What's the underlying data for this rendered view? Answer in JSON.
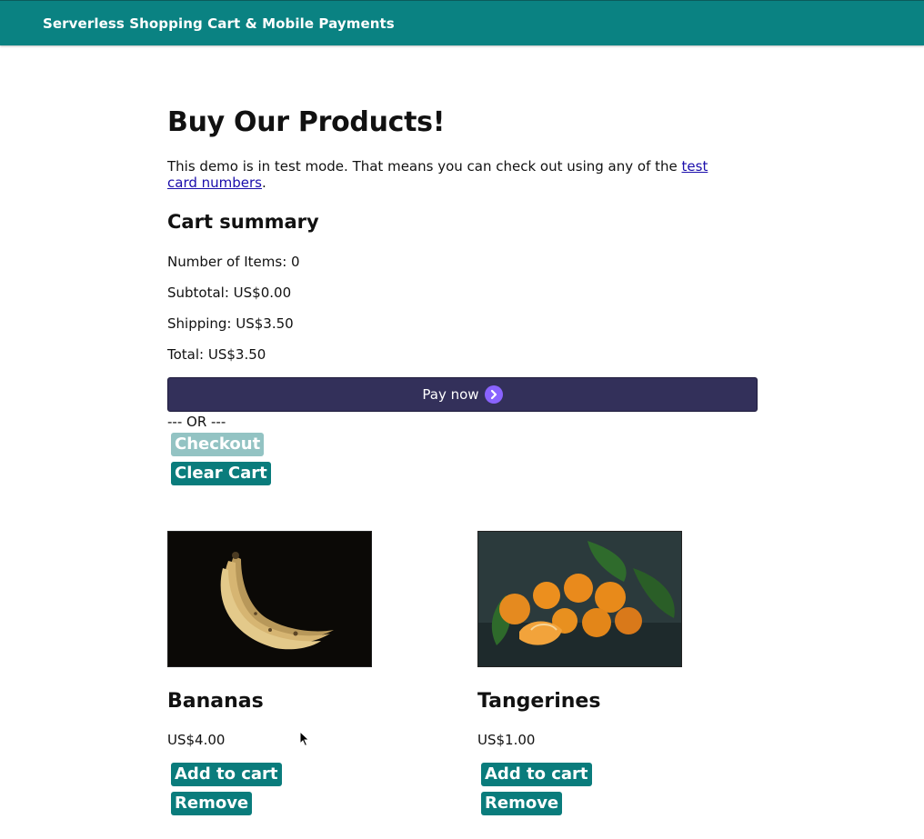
{
  "header": {
    "title": "Serverless Shopping Cart & Mobile Payments"
  },
  "page": {
    "title": "Buy Our Products!",
    "intro_text": "This demo is in test mode. That means you can check out using any of the ",
    "intro_link": "test card numbers",
    "intro_end": "."
  },
  "cart": {
    "heading": "Cart summary",
    "items": "Number of Items: 0",
    "subtotal": "Subtotal: US$0.00",
    "shipping": "Shipping: US$3.50",
    "total": "Total: US$3.50",
    "pay_label": "Pay now",
    "or_text": "--- OR ---",
    "checkout_label": "Checkout",
    "checkout_disabled": true,
    "clear_label": "Clear Cart"
  },
  "products": [
    {
      "name": "Bananas",
      "price": "US$4.00",
      "add_label": "Add to cart",
      "remove_label": "Remove",
      "image": "bananas-photo"
    },
    {
      "name": "Tangerines",
      "price": "US$1.00",
      "add_label": "Add to cart",
      "remove_label": "Remove",
      "image": "tangerines-photo"
    }
  ],
  "colors": {
    "header_bg": "#0a8282",
    "button_bg": "#0a7c7c",
    "button_disabled_bg": "#93c3c3",
    "pay_button_bg": "#33305a",
    "pay_icon": "#8a63ff"
  }
}
